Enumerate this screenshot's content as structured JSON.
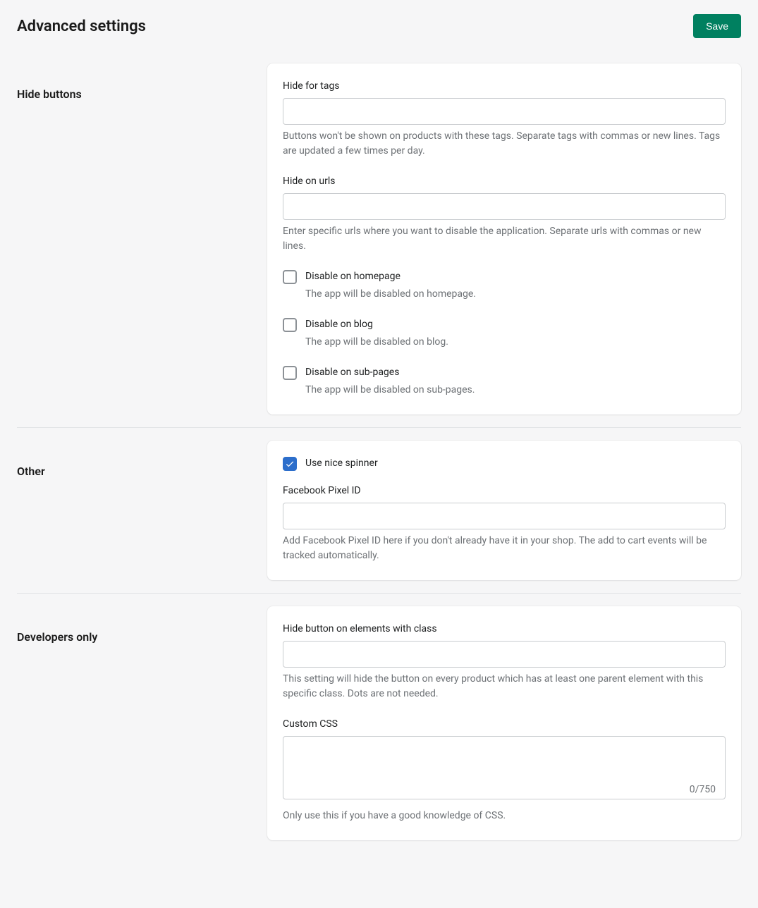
{
  "header": {
    "title": "Advanced settings",
    "save_label": "Save"
  },
  "sections": {
    "hide_buttons": {
      "title": "Hide buttons",
      "hide_for_tags": {
        "label": "Hide for tags",
        "value": "",
        "help": "Buttons won't be shown on products with these tags. Separate tags with commas or new lines. Tags are updated a few times per day."
      },
      "hide_on_urls": {
        "label": "Hide on urls",
        "value": "",
        "help": "Enter specific urls where you want to disable the application. Separate urls with commas or new lines."
      },
      "disable_homepage": {
        "label": "Disable on homepage",
        "help": "The app will be disabled on homepage.",
        "checked": false
      },
      "disable_blog": {
        "label": "Disable on blog",
        "help": "The app will be disabled on blog.",
        "checked": false
      },
      "disable_subpages": {
        "label": "Disable on sub-pages",
        "help": "The app will be disabled on sub-pages.",
        "checked": false
      }
    },
    "other": {
      "title": "Other",
      "use_nice_spinner": {
        "label": "Use nice spinner",
        "checked": true
      },
      "fb_pixel": {
        "label": "Facebook Pixel ID",
        "value": "",
        "help": "Add Facebook Pixel ID here if you don't already have it in your shop. The add to cart events will be tracked automatically."
      }
    },
    "developers": {
      "title": "Developers only",
      "hide_class": {
        "label": "Hide button on elements with class",
        "value": "",
        "help": "This setting will hide the button on every product which has at least one parent element with this specific class. Dots are not needed."
      },
      "custom_css": {
        "label": "Custom CSS",
        "value": "",
        "counter": "0/750",
        "help": "Only use this if you have a good knowledge of CSS."
      }
    }
  }
}
